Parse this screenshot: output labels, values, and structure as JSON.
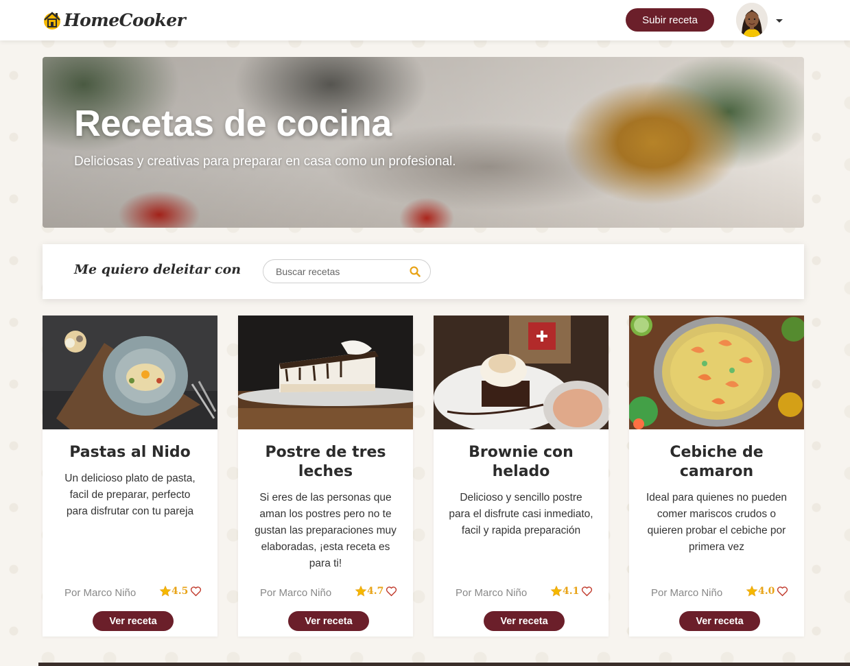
{
  "header": {
    "logo_text": "HomeCooker",
    "upload_label": "Subir receta",
    "user_menu_icon": "caret-down-icon"
  },
  "hero": {
    "title": "Recetas de cocina",
    "subtitle": "Deliciosas y creativas para preparar en casa como un profesional."
  },
  "search": {
    "label": "Me quiero deleitar con",
    "placeholder": "Buscar recetas",
    "icon": "search-icon"
  },
  "recipes": [
    {
      "title": "Pastas al Nido",
      "description": "Un delicioso plato de pasta, facil de preparar, perfecto para disfrutar con tu pareja",
      "author": "Por Marco Niño",
      "rating": "4.5",
      "button": "Ver receta"
    },
    {
      "title": "Postre de tres leches",
      "description": "Si eres de las personas que aman los postres pero no te gustan las preparaciones muy elaboradas, ¡esta receta es para ti!",
      "author": "Por Marco Niño",
      "rating": "4.7",
      "button": "Ver receta"
    },
    {
      "title": "Brownie con helado",
      "description": "Delicioso y sencillo postre para el disfrute casi inmediato, facil y rapida preparación",
      "author": "Por Marco Niño",
      "rating": "4.1",
      "button": "Ver receta"
    },
    {
      "title": "Cebiche de camaron",
      "description": "Ideal para quienes no pueden comer mariscos crudos o quieren probar el cebiche por primera vez",
      "author": "Por Marco Niño",
      "rating": "4.0",
      "button": "Ver receta"
    }
  ],
  "colors": {
    "brand": "#6b1f2a",
    "accent": "#e8a317",
    "heart": "#c0392b"
  }
}
